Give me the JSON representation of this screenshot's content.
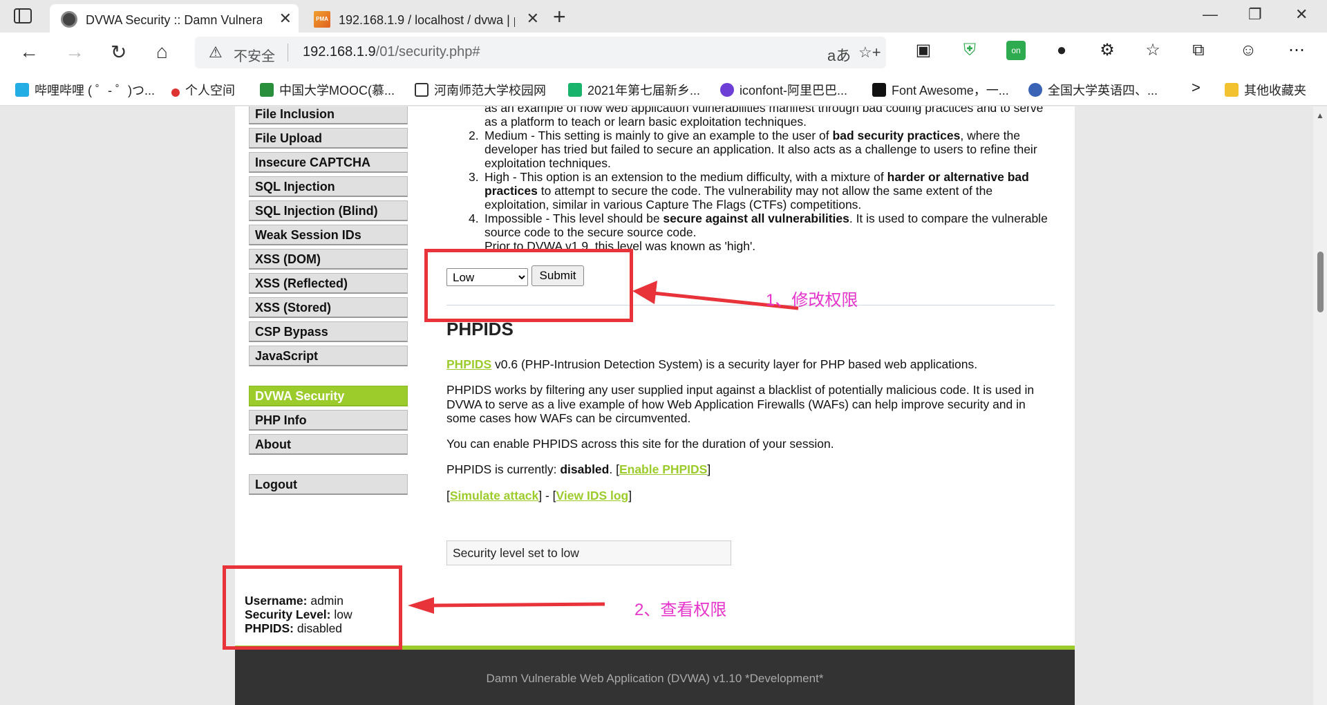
{
  "browser": {
    "tabs": [
      {
        "title": "DVWA Security :: Damn Vulnerab",
        "close": "✕"
      },
      {
        "title": "192.168.1.9 / localhost / dvwa | p",
        "close": "✕",
        "favicon_text": "PMA"
      }
    ],
    "new_tab": "+",
    "window_controls": [
      "—",
      "❐",
      "✕"
    ],
    "nav": {
      "back": "←",
      "forward": "→",
      "reload": "↻",
      "home": "⌂"
    },
    "address": {
      "insecure_label": "不安全",
      "url_host": "192.168.1.9",
      "url_path": "/01/security.php#"
    },
    "omnibox_icons": [
      "aあ",
      "☆+"
    ],
    "extensions": [
      "▣",
      "⛨",
      "on",
      "●",
      "⚙",
      "☆",
      "⧉",
      "☺",
      "⋯"
    ],
    "bookmarks": [
      {
        "label": "哔哩哔哩 ( ゜- ゜)つ...",
        "icon_color": "#23ade5"
      },
      {
        "label": "个人空间",
        "icon_color": "#d33"
      },
      {
        "label": "中国大学MOOC(慕...",
        "icon_color": "#2a8f3c"
      },
      {
        "label": "河南师范大学校园网",
        "icon_color": "#ffffff"
      },
      {
        "label": "2021年第七届新乡...",
        "icon_color": "#19b36b"
      },
      {
        "label": "iconfont-阿里巴巴...",
        "icon_color": "#6d3fd6"
      },
      {
        "label": "Font Awesome，一...",
        "icon_color": "#111"
      },
      {
        "label": "全国大学英语四、...",
        "icon_color": "#3b63b5"
      },
      {
        "label": "其他收藏夹",
        "icon_color": "#f2c230"
      }
    ],
    "bookmarks_more": ">"
  },
  "menu": {
    "items": [
      "File Inclusion",
      "File Upload",
      "Insecure CAPTCHA",
      "SQL Injection",
      "SQL Injection (Blind)",
      "Weak Session IDs",
      "XSS (DOM)",
      "XSS (Reflected)",
      "XSS (Stored)",
      "CSP Bypass",
      "JavaScript"
    ],
    "security": "DVWA Security",
    "php_info": "PHP Info",
    "about": "About",
    "logout": "Logout"
  },
  "main": {
    "list_top_clipped": "as an example of how web application vulnerabilities manifest through bad coding practices and to serve",
    "list_top_line2": "as a platform to teach or learn basic exploitation techniques.",
    "item2_num": "2.",
    "item2_a": "Medium - This setting is mainly to give an example to the user of ",
    "item2_b": "bad security practices",
    "item2_c": ", where the developer has tried but failed to secure an application. It also acts as a challenge to users to refine their exploitation techniques.",
    "item3_num": "3.",
    "item3_a": "High - This option is an extension to the medium difficulty, with a mixture of ",
    "item3_b": "harder or alternative bad practices",
    "item3_c": " to attempt to secure the code. The vulnerability may not allow the same extent of the exploitation, similar in various Capture The Flags (CTFs) competitions.",
    "item4_num": "4.",
    "item4_a": "Impossible - This level should be ",
    "item4_b": "secure against all vulnerabilities",
    "item4_c": ". It is used to compare the vulnerable source code to the secure source code.",
    "item4_d": "Prior to DVWA v1.9, this level was known as 'high'.",
    "select_value": "Low",
    "submit_label": "Submit",
    "phpids_heading": "PHPIDS",
    "phpids_link": "PHPIDS",
    "phpids_desc": " v0.6 (PHP-Intrusion Detection System) is a security layer for PHP based web applications.",
    "phpids_p2": "PHPIDS works by filtering any user supplied input against a blacklist of potentially malicious code. It is used in DVWA to serve as a live example of how Web Application Firewalls (WAFs) can help improve security and in some cases how WAFs can be circumvented.",
    "phpids_p3": "You can enable PHPIDS across this site for the duration of your session.",
    "status_prefix": "PHPIDS is currently: ",
    "status_value": "disabled",
    "status_mid": ". [",
    "enable_link": "Enable PHPIDS",
    "status_end": "]",
    "bracket_open": "[",
    "simulate_link": "Simulate attack",
    "sep": "] - [",
    "view_log_link": "View IDS log",
    "bracket_close": "]",
    "message": "Security level set to low"
  },
  "userinfo": {
    "username_label": "Username:",
    "username": " admin",
    "level_label": "Security Level:",
    "level": " low",
    "phpids_label": "PHPIDS:",
    "phpids": " disabled"
  },
  "footer": "Damn Vulnerable Web Application (DVWA) v1.10 *Development*",
  "annotations": {
    "note1": "1、修改权限",
    "note2": "2、查看权限",
    "color_box": "#e8333a",
    "color_note": "#e633cc"
  }
}
